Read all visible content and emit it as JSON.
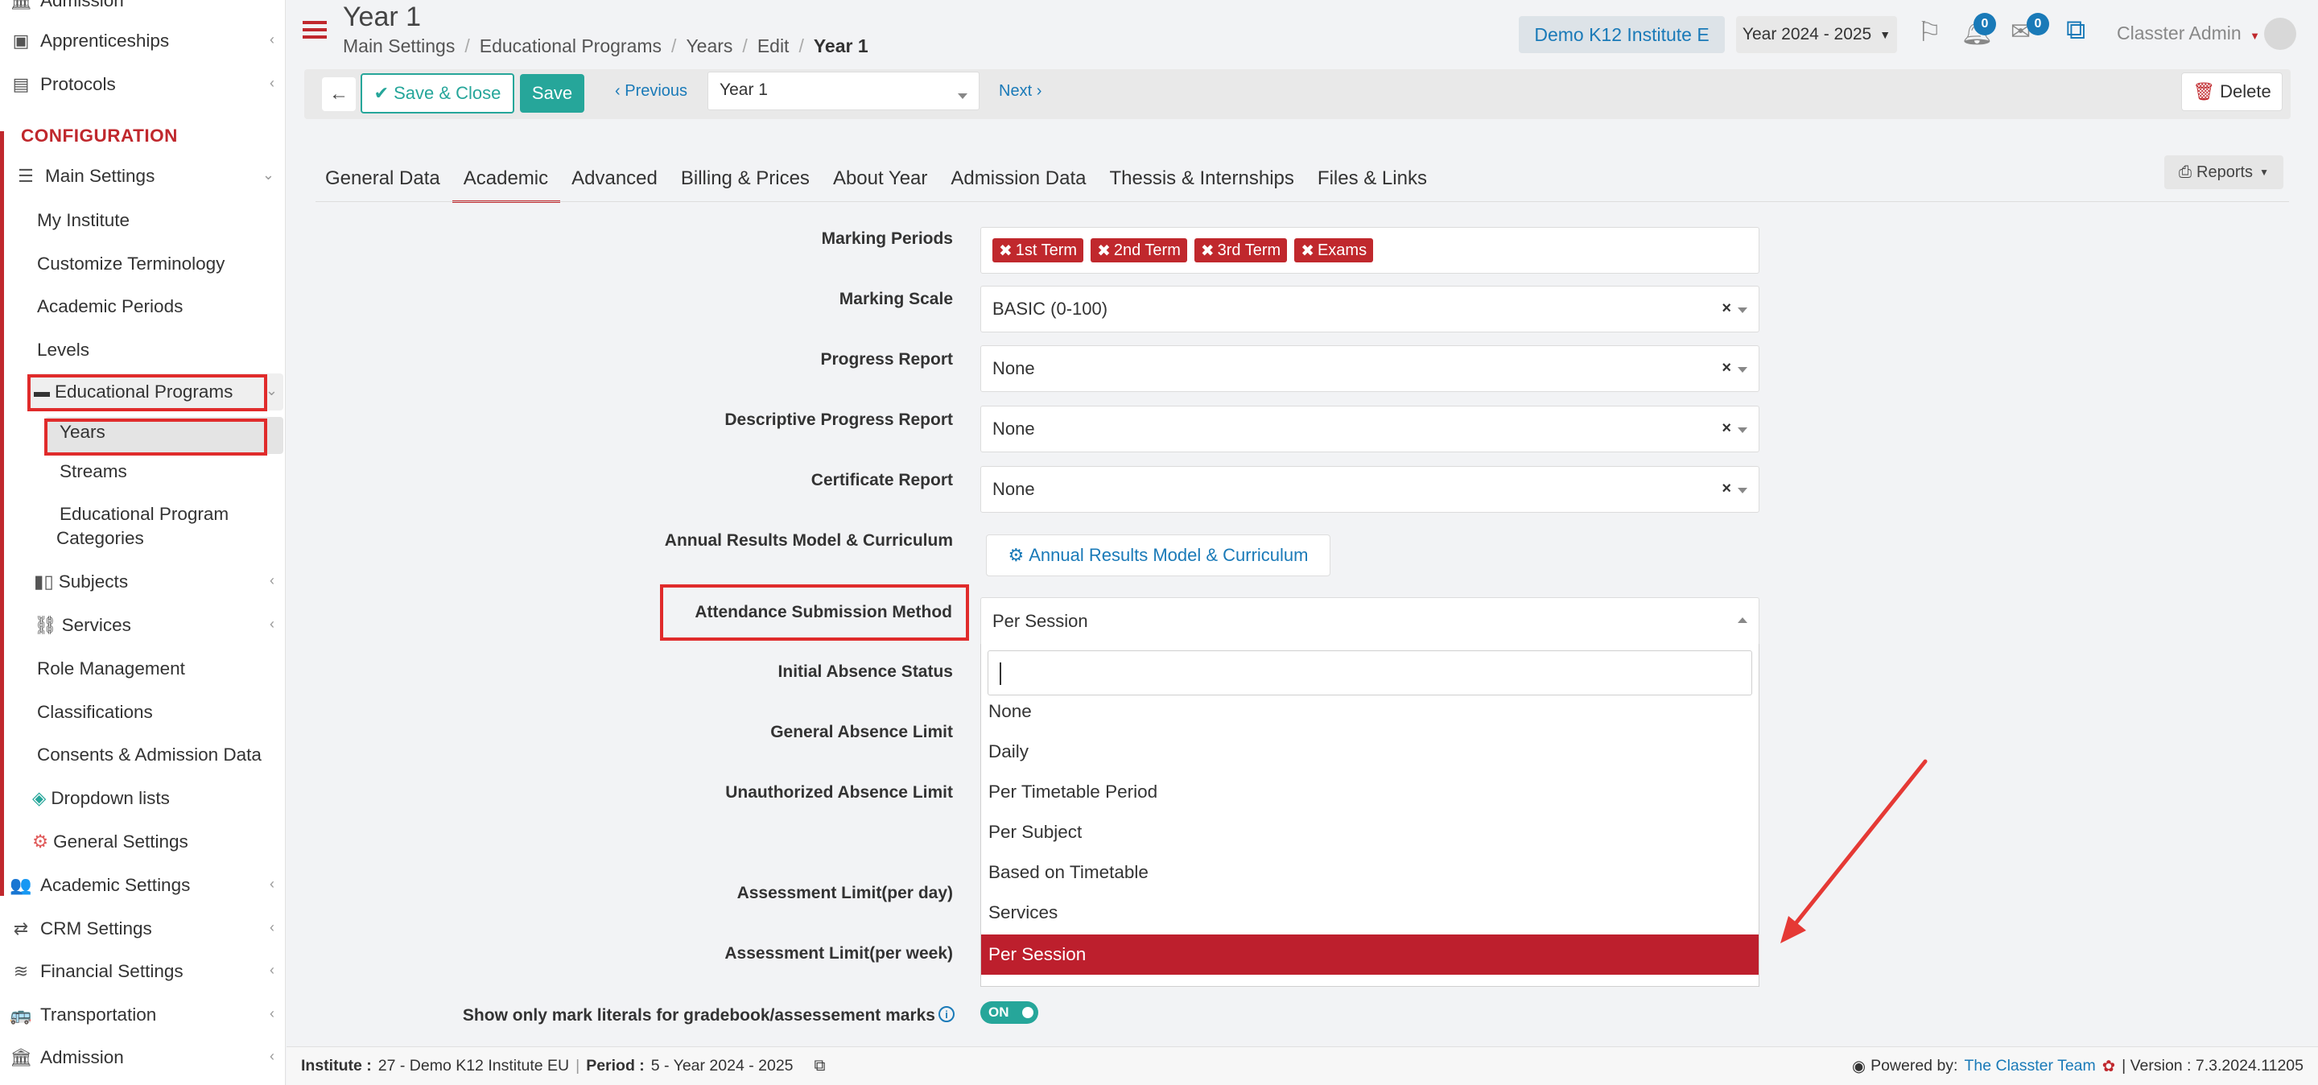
{
  "sidebar": {
    "top_items": [
      {
        "label": "Admission"
      },
      {
        "label": "Apprenticeships"
      },
      {
        "label": "Protocols"
      }
    ],
    "section_title": "CONFIGURATION",
    "main_settings": "Main Settings",
    "sub_items": [
      "My Institute",
      "Customize Terminology",
      "Academic Periods",
      "Levels"
    ],
    "educational_programs": "Educational Programs",
    "ep_children": [
      "Years",
      "Streams"
    ],
    "ep_categories_line1": "Educational Program",
    "ep_categories_line2": "Categories",
    "subjects": "Subjects",
    "services": "Services",
    "more_items": [
      "Role Management",
      "Classifications",
      "Consents & Admission Data"
    ],
    "dropdown_lists": "Dropdown lists",
    "general_settings": "General Settings",
    "bottom_items": [
      "Academic Settings",
      "CRM Settings",
      "Financial Settings",
      "Transportation",
      "Admission"
    ]
  },
  "header": {
    "title": "Year 1",
    "breadcrumb": [
      "Main Settings",
      "Educational Programs",
      "Years",
      "Edit",
      "Year 1"
    ],
    "institute_button": "Demo K12 Institute E",
    "period_select": "Year 2024 - 2025",
    "notifications_count": "0",
    "messages_count": "0",
    "user_name": "Classter Admin"
  },
  "toolbar": {
    "save_close": "Save & Close",
    "save": "Save",
    "previous": "Previous",
    "record_select": "Year 1",
    "next": "Next",
    "delete": "Delete"
  },
  "tabs": [
    "General Data",
    "Academic",
    "Advanced",
    "Billing & Prices",
    "About Year",
    "Admission Data",
    "Thessis & Internships",
    "Files & Links"
  ],
  "reports_button": "Reports",
  "form": {
    "marking_periods_label": "Marking Periods",
    "marking_periods": [
      "1st Term",
      "2nd Term",
      "3rd Term",
      "Exams"
    ],
    "marking_scale_label": "Marking Scale",
    "marking_scale": "BASIC (0-100)",
    "progress_report_label": "Progress Report",
    "progress_report": "None",
    "descriptive_label": "Descriptive Progress Report",
    "descriptive": "None",
    "certificate_label": "Certificate Report",
    "certificate": "None",
    "annual_label": "Annual Results Model & Curriculum",
    "annual_button": "Annual Results Model & Curriculum",
    "attendance_label": "Attendance Submission Method",
    "attendance_value": "Per Session",
    "initial_absence_label": "Initial Absence Status",
    "general_absence_label": "General Absence Limit",
    "unauthorized_label": "Unauthorized Absence Limit",
    "assess_day_label": "Assessment Limit(per day)",
    "assess_week_label": "Assessment Limit(per week)",
    "literals_label": "Show only mark literals for gradebook/assessement marks",
    "literals_toggle": "ON"
  },
  "dropdown": {
    "search_value": "",
    "options": [
      "None",
      "Daily",
      "Per Timetable Period",
      "Per Subject",
      "Based on Timetable",
      "Services",
      "Per Session"
    ],
    "selected": "Per Session"
  },
  "footer": {
    "institute_key": "Institute :",
    "institute_val": "27 - Demo K12 Institute EU",
    "period_key": "Period :",
    "period_val": "5 - Year 2024 - 2025",
    "powered_by": "Powered by:",
    "powered_link": "The Classter Team",
    "version": "| Version : 7.3.2024.11205"
  },
  "colors": {
    "accent": "#c0282d",
    "teal": "#26a69a",
    "link": "#1a7ab8"
  }
}
